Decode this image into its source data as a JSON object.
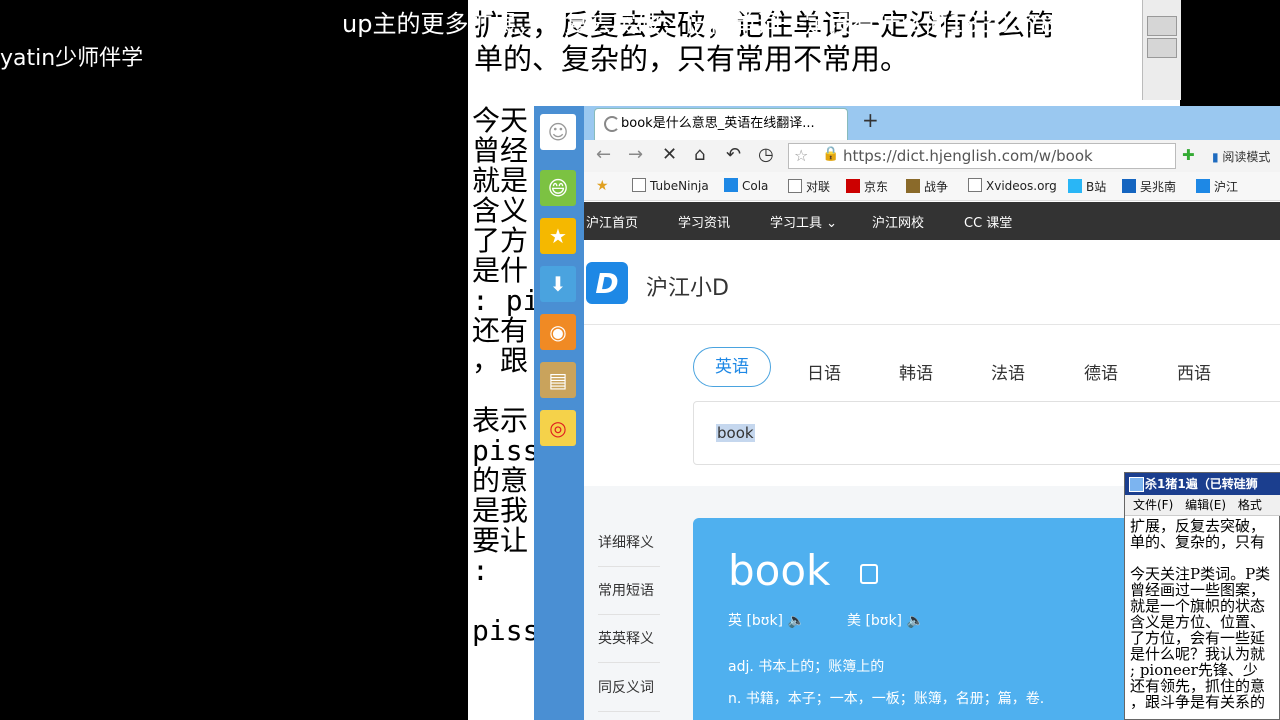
{
  "overlay": {
    "top_banner": "up主的更多扩展，反复去突破，记住单词一定没有什么简",
    "top_banner_number": "183037819",
    "streamer_name": "yatin少师伴学"
  },
  "background_notepad": {
    "top_lines": [
      "扩展，反复去突破，记住单词一定没有什么简",
      "单的、复杂的，只有常用不常用。"
    ],
    "left_column": [
      "今天",
      "曾经",
      "就是",
      "含义",
      "了方",
      "是什",
      ": pi",
      "还有",
      "，跟",
      "",
      "表示",
      "piss",
      "的意",
      "是我",
      "要让",
      ":",
      "",
      "piss"
    ]
  },
  "sidebar_icons": [
    "smiley-icon",
    "emoji-icon",
    "star-icon",
    "download-icon",
    "rss-icon",
    "notes-icon",
    "weibo-icon"
  ],
  "browser": {
    "tab_title": "book是什么意思_英语在线翻译...",
    "new_tab": "+",
    "url": "https://dict.hjenglish.com/w/book",
    "reader_mode": "阅读模式",
    "bookmarks": [
      "TubeNinja",
      "Cola",
      "对联",
      "京东",
      "战争",
      "Xvideos.org",
      "B站",
      "吴兆南",
      "沪江"
    ],
    "top_nav": [
      "沪江首页",
      "学习资讯",
      "学习工具",
      "沪江网校",
      "CC 课堂"
    ],
    "brand_letter": "D",
    "brand_name": "沪江小D",
    "languages": [
      "英语",
      "日语",
      "韩语",
      "法语",
      "德语",
      "西语"
    ],
    "search_value": "book",
    "side_menu": [
      "详细释义",
      "常用短语",
      "英英释义",
      "同反义词"
    ],
    "word": "book",
    "phonetic_uk": "英 [bʊk]",
    "phonetic_us": "美 [bʊk]",
    "def_adj": "adj. 书本上的；账簿上的",
    "def_n": "n. 书籍，本子；一本，一板；账簿，名册；篇，卷."
  },
  "foreground_notepad": {
    "title": "杀1猪1遍（已转硅狮",
    "menu": [
      "文件(F)",
      "编辑(E)",
      "格式"
    ],
    "lines": [
      "扩展，反复去突破，",
      "单的、复杂的，只有",
      "",
      "今天关注P类词。P类",
      "曾经画过一些图案，",
      "就是一个旗帜的状态",
      "含义是方位、位置、",
      "了方位，会有一些延",
      "是什么呢？我认为就",
      "; pioneer先锋、少",
      "还有领先，抓住的意",
      "，跟斗争是有关系的"
    ]
  }
}
